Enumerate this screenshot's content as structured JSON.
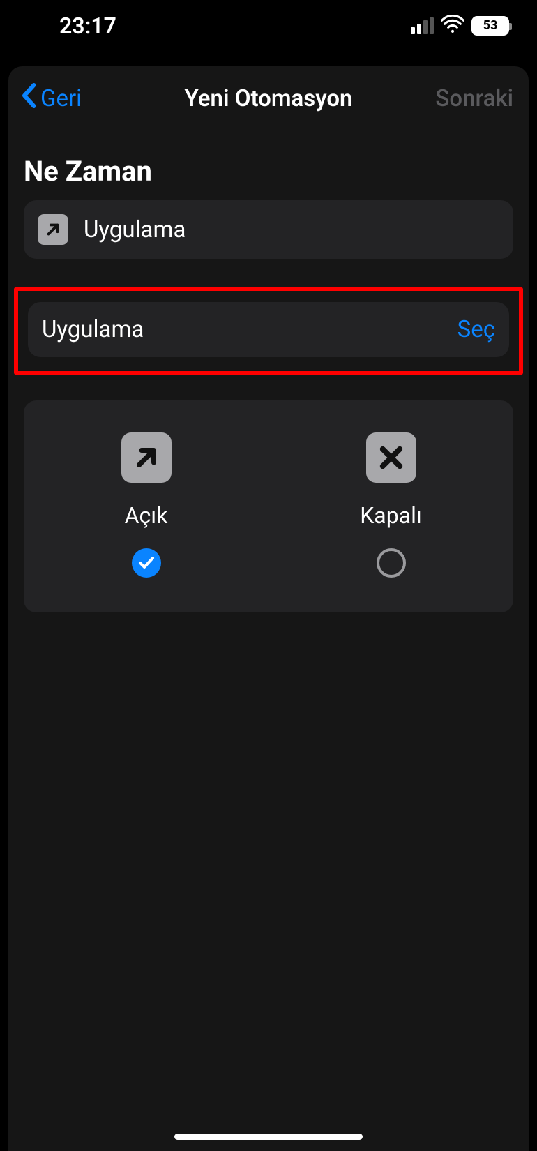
{
  "status": {
    "time": "23:17",
    "battery": "53"
  },
  "nav": {
    "back": "Geri",
    "title": "Yeni Otomasyon",
    "next": "Sonraki"
  },
  "section": {
    "when_title": "Ne Zaman",
    "trigger_label": "Uygulama",
    "select_label": "Uygulama",
    "select_action": "Seç"
  },
  "options": {
    "open_label": "Açık",
    "closed_label": "Kapalı",
    "selected": "open"
  }
}
